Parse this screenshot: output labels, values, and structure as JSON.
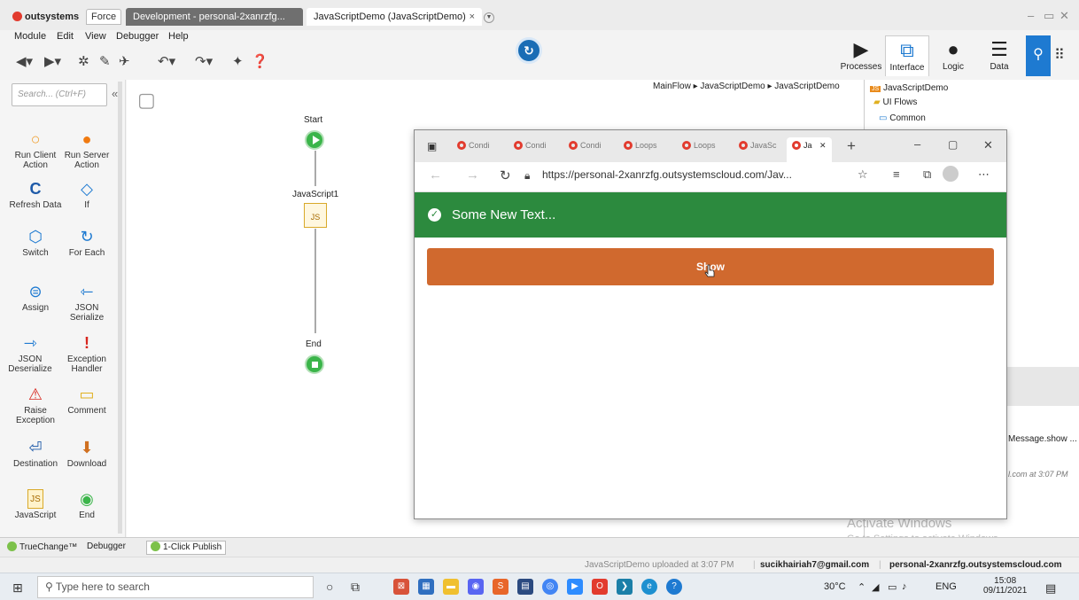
{
  "titlebar": {
    "brand": "outsystems",
    "force_tab": "Force",
    "dev_tab": "Development - personal-2xanrzfg...",
    "active_tab": "JavaScriptDemo (JavaScriptDemo)",
    "close": "×"
  },
  "menu": [
    "Module",
    "Edit",
    "View",
    "Debugger",
    "Help"
  ],
  "module_tabs": [
    {
      "label": "Processes",
      "icon": "processes-icon"
    },
    {
      "label": "Interface",
      "icon": "interface-icon"
    },
    {
      "label": "Logic",
      "icon": "logic-icon"
    },
    {
      "label": "Data",
      "icon": "data-icon"
    }
  ],
  "toolbox": {
    "search_placeholder": "Search... (Ctrl+F)",
    "tools": [
      {
        "label": "Run Client Action",
        "icon": "○"
      },
      {
        "label": "Run Server Action",
        "icon": "●"
      },
      {
        "label": "Refresh Data",
        "icon": "C"
      },
      {
        "label": "If",
        "icon": "◇"
      },
      {
        "label": "Switch",
        "icon": "⬡"
      },
      {
        "label": "For Each",
        "icon": "↻"
      },
      {
        "label": "Assign",
        "icon": "⊜"
      },
      {
        "label": "JSON Serialize",
        "icon": "⇽"
      },
      {
        "label": "JSON Deserialize",
        "icon": "⇾"
      },
      {
        "label": "Exception Handler",
        "icon": "!"
      },
      {
        "label": "Raise Exception",
        "icon": "⚠"
      },
      {
        "label": "Comment",
        "icon": "▭"
      },
      {
        "label": "Destination",
        "icon": "⏎"
      },
      {
        "label": "Download",
        "icon": "⬇"
      },
      {
        "label": "JavaScript",
        "icon": "JS"
      },
      {
        "label": "End",
        "icon": "◉"
      }
    ]
  },
  "canvas": {
    "breadcrumb": "MainFlow ▸ JavaScriptDemo ▸ JavaScriptDemo",
    "start_label": "Start",
    "js_label": "JavaScript1",
    "js_node_text": "JS",
    "end_label": "End"
  },
  "tree": {
    "root": "JavaScriptDemo",
    "ui_flows": "UI Flows",
    "common": "Common"
  },
  "right_panel": {
    "message": "Message.show ...",
    "uploaded": "l.com at 3:07 PM",
    "activate_title": "Activate Windows",
    "activate_sub": "Go to Settings to activate Windows."
  },
  "bottom_tabs": [
    "TrueChange™",
    "Debugger",
    "1-Click Publish"
  ],
  "status": {
    "upload": "JavaScriptDemo uploaded at 3:07 PM",
    "user": "sucikhairiah7@gmail.com",
    "server": "personal-2xanrzfg.outsystemscloud.com"
  },
  "taskbar": {
    "search_placeholder": "Type here to search",
    "weather": "30°C",
    "lang": "ENG",
    "time": "15:08",
    "date": "09/11/2021"
  },
  "browser": {
    "tabs": [
      "Condi",
      "Condi",
      "Condi",
      "Loops",
      "Loops",
      "JavaSc",
      "Ja"
    ],
    "url": "https://personal-2xanrzfg.outsystemscloud.com/Jav...",
    "feedback": "Some New Text...",
    "button": "Show"
  }
}
